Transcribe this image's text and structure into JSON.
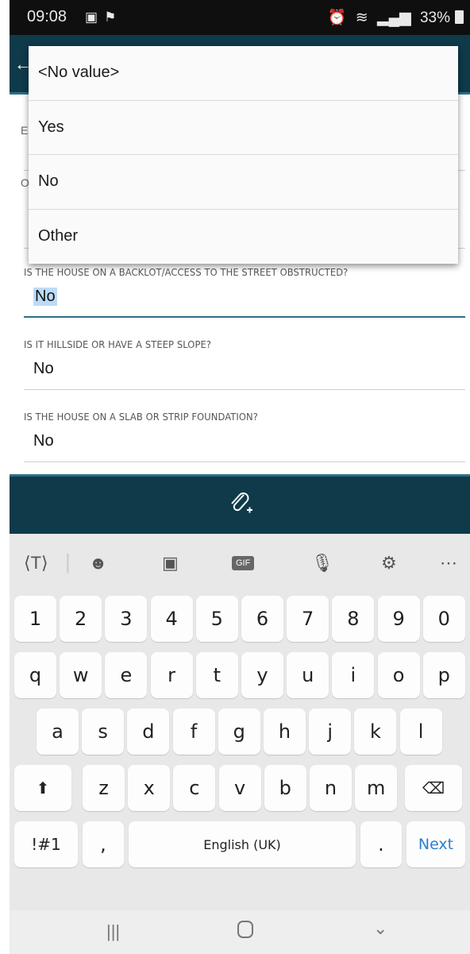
{
  "status_bar": {
    "time": "09:08",
    "left_icons": [
      "gallery-icon",
      "flag-icon"
    ],
    "battery": "33%"
  },
  "dropdown": {
    "options": [
      "<No value>",
      "Yes",
      "No",
      "Other"
    ]
  },
  "form": {
    "partial_labels": [
      "E",
      "O"
    ],
    "fields": [
      {
        "label": "IS THE HOUSE ON A BACKLOT/ACCESS TO THE STREET OBSTRUCTED?",
        "value": "No"
      },
      {
        "label": "IS IT HILLSIDE OR HAVE A STEEP SLOPE?",
        "value": "No"
      },
      {
        "label": "IS THE HOUSE ON A SLAB OR STRIP FOUNDATION?",
        "value": "No"
      }
    ]
  },
  "attachment_bar": {
    "icon": "attach-add-icon"
  },
  "keyboard": {
    "toolbar": [
      "translate-icon",
      "emoji-icon",
      "sticker-icon",
      "GIF",
      "mic-icon",
      "gear-icon",
      "more-icon"
    ],
    "number_row": [
      "1",
      "2",
      "3",
      "4",
      "5",
      "6",
      "7",
      "8",
      "9",
      "0"
    ],
    "row1": [
      "q",
      "w",
      "e",
      "r",
      "t",
      "y",
      "u",
      "i",
      "o",
      "p"
    ],
    "row2": [
      "a",
      "s",
      "d",
      "f",
      "g",
      "h",
      "j",
      "k",
      "l"
    ],
    "row3": [
      "z",
      "x",
      "c",
      "v",
      "b",
      "n",
      "m"
    ],
    "symbols_label": "!#1",
    "comma": ",",
    "space_label": "English (UK)",
    "period": ".",
    "action_label": "Next"
  },
  "nav_bar": {
    "buttons": [
      "recents-icon",
      "home-icon",
      "back-icon"
    ]
  },
  "colors": {
    "header": "#0e3a4a",
    "accent": "#2c6e86",
    "selection": "#bcdcf6",
    "next": "#2a7fd0"
  }
}
